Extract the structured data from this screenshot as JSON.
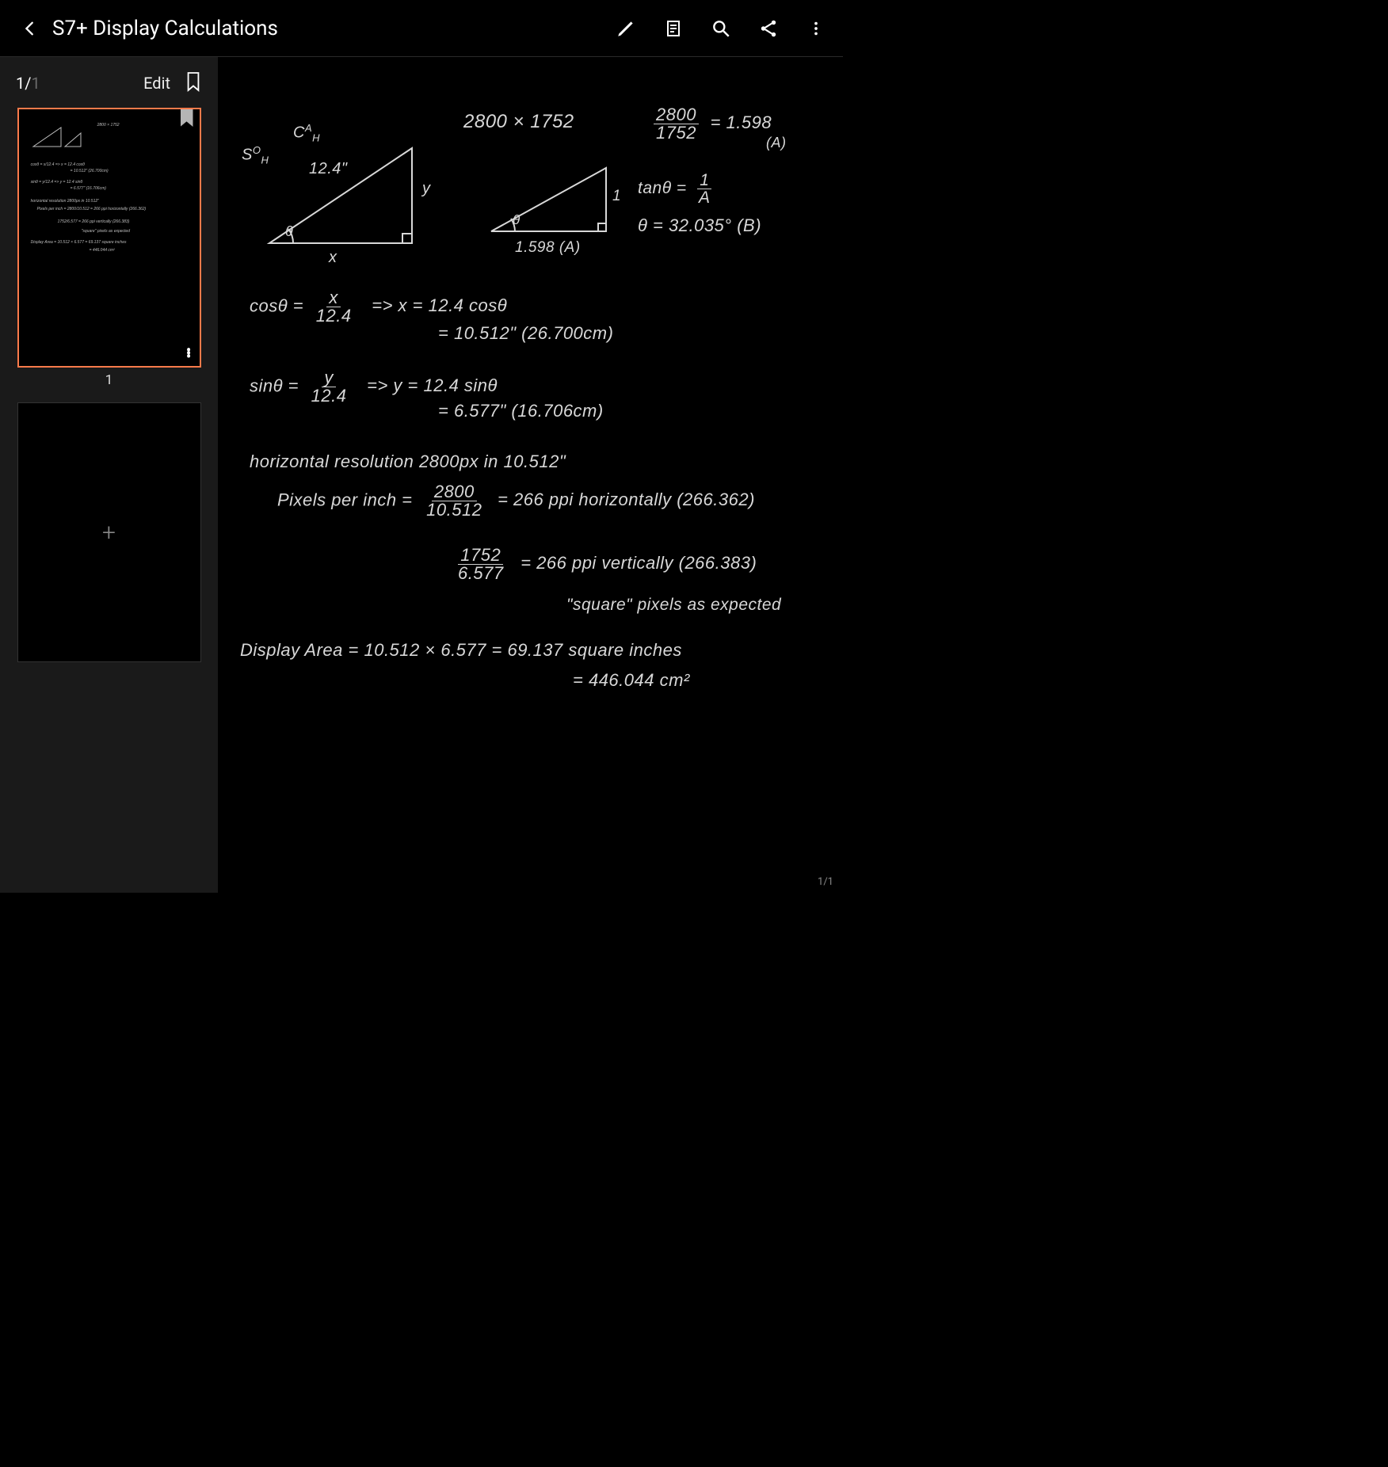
{
  "header": {
    "title": "S7+ Display Calculations"
  },
  "sidebar": {
    "page_current": "1/",
    "page_total": "1",
    "edit_label": "Edit",
    "thumb1_label": "1"
  },
  "footer": {
    "page_indicator": "1/1"
  },
  "notes": {
    "soh": "S",
    "soh_sub": "H",
    "soh_sup": "O",
    "cah": "C",
    "cah_sub": "H",
    "cah_sup": "A",
    "tri1_hyp": "12.4\"",
    "tri1_x": "x",
    "tri1_y": "y",
    "tri1_theta": "θ",
    "resolution": "2800 × 1752",
    "ratio_num": "2800",
    "ratio_den": "1752",
    "ratio_eq": "= 1.598",
    "ratio_label": "(A)",
    "tri2_base": "1.598 (A)",
    "tri2_side": "1",
    "tri2_theta": "θ",
    "tan_eq_lhs": "tanθ =",
    "tan_eq_num": "1",
    "tan_eq_den": "A",
    "theta_eq": "θ = 32.035° (B)",
    "cos_lhs": "cosθ =",
    "cos_num": "x",
    "cos_den": "12.4",
    "cos_rhs1": "=> x = 12.4 cosθ",
    "cos_rhs2": "= 10.512\" (26.700cm)",
    "sin_lhs": "sinθ =",
    "sin_num": "y",
    "sin_den": "12.4",
    "sin_rhs1": "=> y = 12.4 sinθ",
    "sin_rhs2": "= 6.577\" (16.706cm)",
    "hres": "horizontal resolution 2800px in 10.512\"",
    "ppi_lhs": "Pixels per inch =",
    "ppi_num": "2800",
    "ppi_den": "10.512",
    "ppi_rhs": "= 266 ppi  horizontally (266.362)",
    "ppi2_num": "1752",
    "ppi2_den": "6.577",
    "ppi2_rhs": "= 266 ppi vertically (266.383)",
    "square_note": "\"square\" pixels as expected",
    "area_line1": "Display Area = 10.512 × 6.577 = 69.137 square inches",
    "area_line2": "= 446.044 cm²"
  },
  "thumb_preview": {
    "l1": "2800 × 1752",
    "l2": "cosθ = x/12.4 => x = 12.4 cosθ",
    "l3": "= 10.512\" (26.700cm)",
    "l4": "sinθ = y/12.4 => y = 12.4 sinθ",
    "l5": "= 6.577\" (16.706cm)",
    "l6": "horizontal resolution 2800px in 10.512\"",
    "l7": "Pixels per inch = 2800/10.512 = 266 ppi horizontally (266.362)",
    "l8": "1752/6.577 = 266 ppi vertically (266.383)",
    "l9": "\"square\" pixels as expected",
    "l10": "Display Area = 10.512 × 6.577 = 69.137 square inches",
    "l11": "= 446.044 cm²"
  }
}
